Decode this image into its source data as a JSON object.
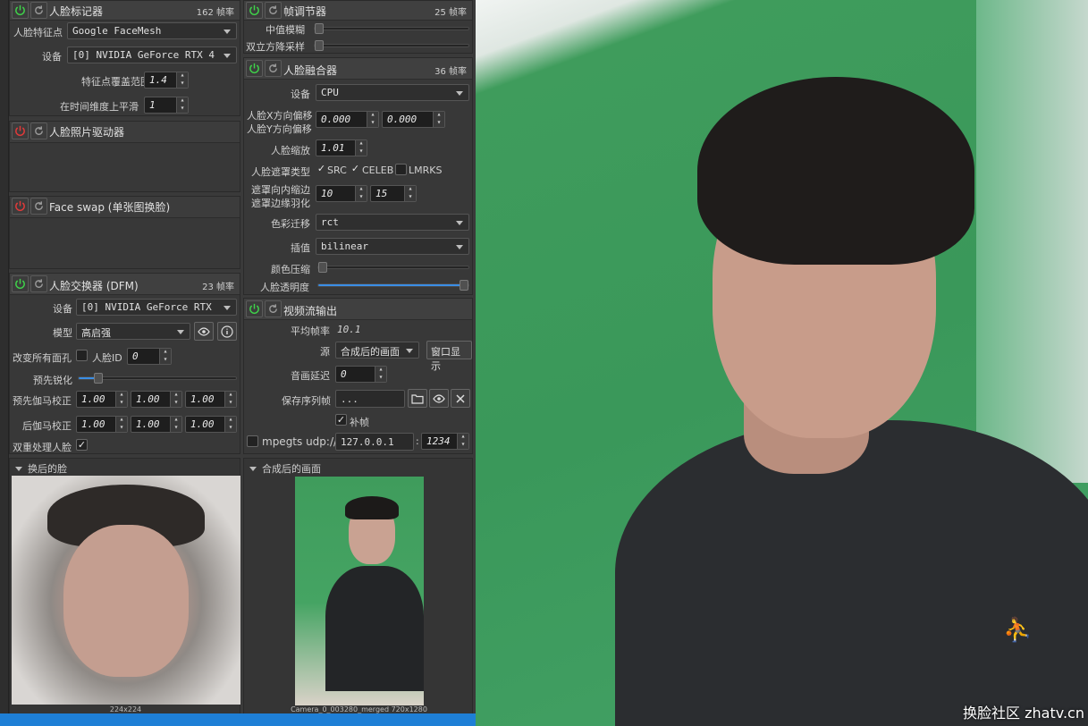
{
  "colors": {
    "green_screen": "#3f9c5c",
    "accent": "#3a8ee6",
    "power_on": "#3fd14a",
    "power_off": "#e03a3a"
  },
  "landmarks": {
    "title": "人脸标记器",
    "fps": "162 帧率",
    "face_type_label": "人脸特征点",
    "face_type_value": "Google FaceMesh",
    "device_label": "设备",
    "device_value": "[0] NVIDIA GeForce RTX 4",
    "coverage_label": "特征点覆盖范围",
    "coverage_value": "1.4",
    "smooth_label": "在时间维度上平滑",
    "smooth_value": "1"
  },
  "animator": {
    "title": "人脸照片驱动器"
  },
  "faceswap_single": {
    "title": "Face swap (单张图换脸)"
  },
  "dfm": {
    "title": "人脸交换器 (DFM)",
    "fps": "23 帧率",
    "device_label": "设备",
    "device_value": "[0] NVIDIA GeForce RTX",
    "model_label": "模型",
    "model_value": "高启强",
    "morph_label": "改变所有面孔",
    "face_id_label": "人脸ID",
    "face_id_value": "0",
    "pre_sharpen_label": "预先锐化",
    "pre_sharpen_value": 0.1,
    "pre_gamma_label": "预先伽马校正",
    "pre_gamma": [
      "1.00",
      "1.00",
      "1.00"
    ],
    "post_gamma_label": "后伽马校正",
    "post_gamma": [
      "1.00",
      "1.00",
      "1.00"
    ],
    "two_pass_label": "双重处理人脸"
  },
  "frame_adjuster": {
    "title": "帧调节器",
    "fps": "25 帧率",
    "median_blur_label": "中值模糊",
    "bilateral_label": "双立方降采样"
  },
  "merger": {
    "title": "人脸融合器",
    "fps": "36 帧率",
    "device_label": "设备",
    "device_value": "CPU",
    "x_offset_label": "人脸X方向偏移",
    "y_offset_label": "人脸Y方向偏移",
    "x_offset_value": "0.000",
    "y_offset_value": "0.000",
    "scale_label": "人脸缩放",
    "scale_value": "1.01",
    "mask_type_label": "人脸遮罩类型",
    "mask_src": "SRC",
    "mask_celeb": "CELEB",
    "mask_lmrks": "LMRKS",
    "erode_label": "遮罩向内缩边",
    "blur_label": "遮罩边缘羽化",
    "erode_value": "10",
    "blur_value": "15",
    "color_transfer_label": "色彩迁移",
    "color_transfer_value": "rct",
    "interp_label": "插值",
    "interp_value": "bilinear",
    "color_compress_label": "颜色压缩",
    "opacity_label": "人脸透明度",
    "opacity_value": 1.0
  },
  "stream_output": {
    "title": "视频流输出",
    "avg_fps_label": "平均帧率",
    "avg_fps_value": "10.1",
    "source_label": "源",
    "source_value": "合成后的画面",
    "window_button": "窗口显示",
    "delay_label": "音画延迟",
    "delay_value": "0",
    "save_label": "保存序列帧",
    "save_value": "...",
    "fill_label": "补帧",
    "mpegts_label": "mpegts udp://",
    "ip_value": "127.0.0.1",
    "port_value": "1234"
  },
  "swapped_face": {
    "title": "换后的脸",
    "size": "224x224"
  },
  "merged_frame": {
    "title": "合成后的画面",
    "caption": "Camera_0_003280_merged 720x1280"
  },
  "watermark": "换脸社区 zhatv.cn"
}
